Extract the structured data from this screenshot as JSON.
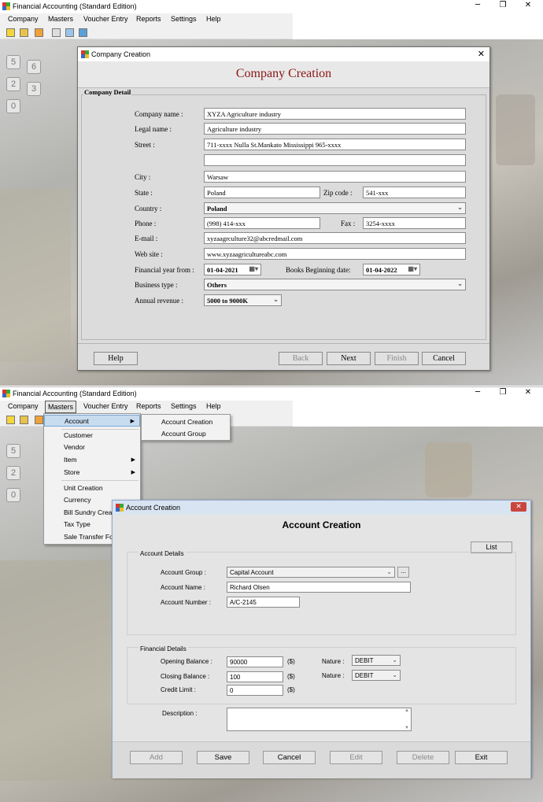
{
  "colors": {
    "title_red": "#8b1515",
    "menu_highlight": "#c7dcef"
  },
  "app": {
    "title": "Financial Accounting (Standard Edition)"
  },
  "menubar": {
    "company": "Company",
    "masters": "Masters",
    "voucher": "Voucher Entry",
    "reports": "Reports",
    "settings": "Settings",
    "help": "Help"
  },
  "window_controls": {
    "minimize": "─",
    "maximize": "❐",
    "close": "✕"
  },
  "company_dialog": {
    "window_title": "Company Creation",
    "heading": "Company Creation",
    "section": "Company Detail",
    "labels": {
      "company_name": "Company name :",
      "legal_name": "Legal name :",
      "street": "Street :",
      "city": "City :",
      "state": "State :",
      "zip": "Zip code :",
      "country": "Country :",
      "phone": "Phone :",
      "fax": "Fax :",
      "email": "E-mail :",
      "web": "Web site :",
      "fy_from": "Financial year from :",
      "books_begin": "Books Beginning date:",
      "business_type": "Business type :",
      "annual_revenue": "Annual revenue :"
    },
    "values": {
      "company_name": "XYZA Agriculture industry",
      "legal_name": "Agriculture industry",
      "street1": "711-xxxx Nulla St.Mankato Mississippi 965-xxxx",
      "street2": "",
      "city": "Warsaw",
      "state": "Poland",
      "zip": "541-xxx",
      "country": "Poland",
      "phone": "(998) 414-xxx",
      "fax": "3254-xxxx",
      "email": "xyzaagrculture32@abcredmail.com",
      "web": "www.xyzaagricultureabc.com",
      "fy_from": "01-04-2021",
      "books_begin": "01-04-2022",
      "business_type": "Others",
      "annual_revenue": "5000 to 9000K"
    },
    "buttons": {
      "help": "Help",
      "back": "Back",
      "next": "Next",
      "finish": "Finish",
      "cancel": "Cancel"
    }
  },
  "masters_menu": {
    "items": [
      "Account",
      "Customer",
      "Vendor",
      "Item",
      "Store",
      "Unit Creation",
      "Currency",
      "Bill Sundry Crea",
      "Tax Type",
      "Sale Transfer Fo"
    ],
    "submenu": [
      "Account Creation",
      "Account Group"
    ]
  },
  "account_dialog": {
    "window_title": "Account Creation",
    "heading": "Account Creation",
    "list_button": "List",
    "section_details": "Account Details",
    "section_financial": "Financial Details",
    "labels": {
      "group": "Account Group :",
      "name": "Account Name :",
      "number": "Account Number :",
      "opening": "Opening Balance :",
      "closing": "Closing Balance :",
      "credit": "Credit Limit :",
      "nature": "Nature :",
      "currency": "($)",
      "description": "Description :"
    },
    "values": {
      "group": "Capital Account",
      "name": "Richard Olsen",
      "number": "A/C-2145",
      "opening": "90000",
      "closing": "100",
      "credit": "0",
      "nature1": "DEBIT",
      "nature2": "DEBIT",
      "browse": "...",
      "description": ""
    },
    "buttons": {
      "add": "Add",
      "save": "Save",
      "cancel": "Cancel",
      "edit": "Edit",
      "delete": "Delete",
      "exit": "Exit"
    }
  }
}
